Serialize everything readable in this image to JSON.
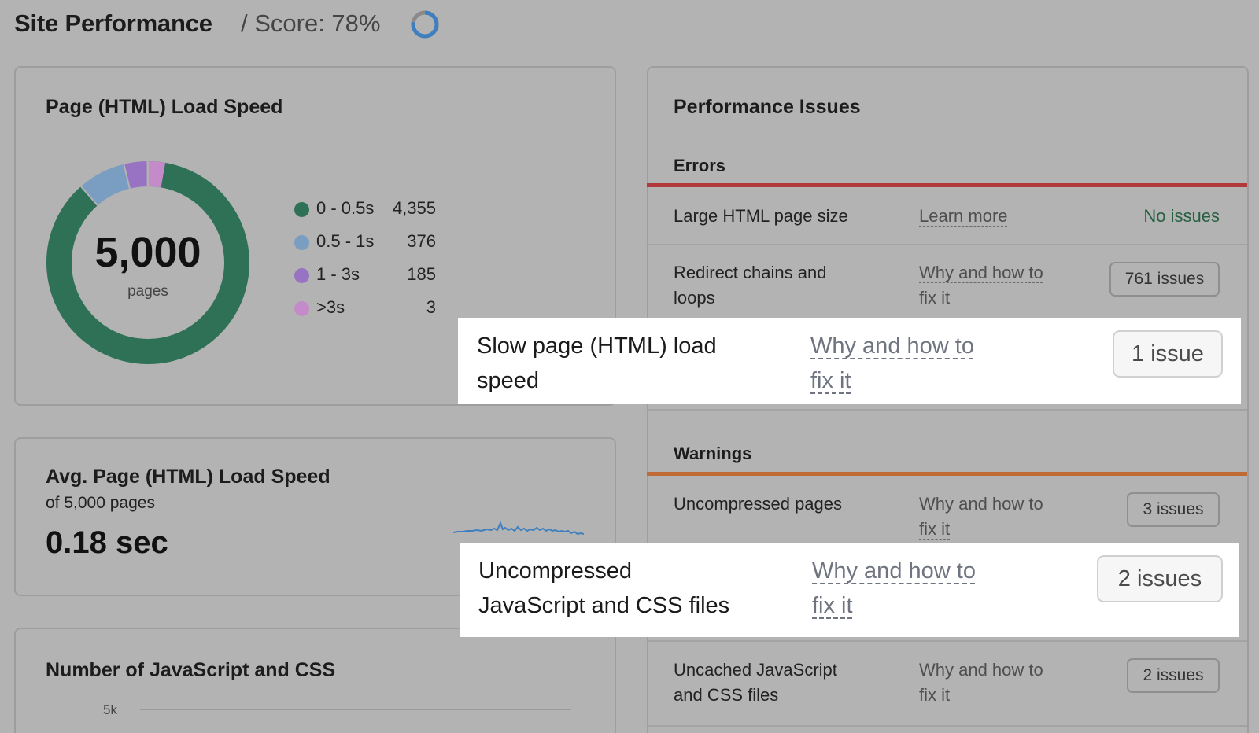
{
  "header": {
    "title": "Site Performance",
    "score": "/ Score: 78%",
    "score_value": 0.78
  },
  "load_speed": {
    "title": "Page (HTML) Load Speed",
    "total": "5,000",
    "total_label": "pages",
    "legend": [
      {
        "label": "0 - 0.5s",
        "value": "4,355",
        "count": 4355,
        "color": "#2e7157"
      },
      {
        "label": "0.5 - 1s",
        "value": "376",
        "count": 376,
        "color": "#7a9ec2"
      },
      {
        "label": "1 - 3s",
        "value": "185",
        "count": 185,
        "color": "#9873c3"
      },
      {
        "label": ">3s",
        "value": "3",
        "count": 3,
        "color": "#c48ac9"
      }
    ]
  },
  "avg_speed": {
    "title": "Avg. Page (HTML) Load Speed",
    "subtitle": "of 5,000 pages",
    "value": "0.18 sec"
  },
  "js_css": {
    "title": "Number of JavaScript and CSS",
    "tick": "5k"
  },
  "issues": {
    "title": "Performance Issues",
    "errors_label": "Errors",
    "warnings_label": "Warnings",
    "errors": [
      {
        "name": "Large HTML page size",
        "link": "Learn more",
        "status": "No issues"
      },
      {
        "name_line1": "Redirect chains and",
        "name_line2": "loops",
        "link_line1": "Why and how to",
        "link_line2": "fix it",
        "status": "761 issues"
      },
      {
        "name_line1": "Slow page (HTML) load",
        "name_line2": "speed",
        "link_line1": "Why and how to",
        "link_line2": "fix it",
        "status": "1 issue"
      }
    ],
    "warnings": [
      {
        "name": "Uncompressed pages",
        "link_line1": "Why and how to",
        "link_line2": "fix it",
        "status": "3 issues"
      },
      {
        "name_line1": "Uncompressed",
        "name_line2": "JavaScript and CSS files",
        "link_line1": "Why and how to",
        "link_line2": "fix it",
        "status": "2 issues"
      },
      {
        "name_line1": "Uncached JavaScript",
        "name_line2": "and CSS files",
        "link_line1": "Why and how to",
        "link_line2": "fix it",
        "status": "2 issues"
      }
    ]
  }
}
